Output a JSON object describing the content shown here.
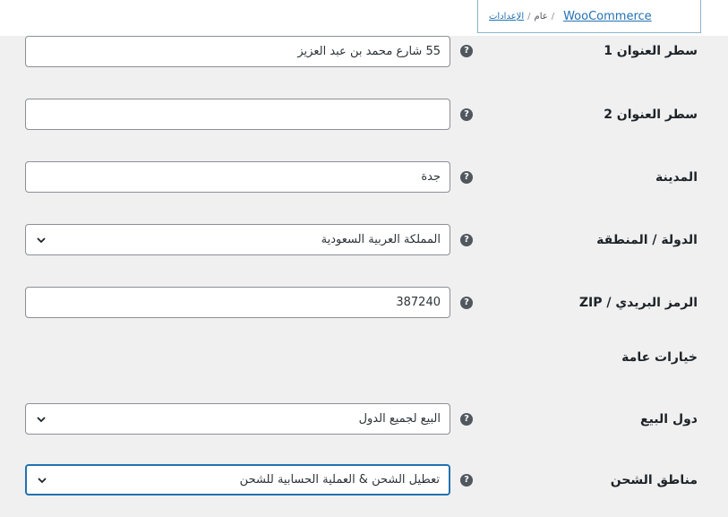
{
  "breadcrumb": {
    "root": "WooCommerce",
    "settings": "الإعدادات",
    "current": "عام",
    "separator": "/"
  },
  "fields": [
    {
      "label": "سطر العنوان 1",
      "value": "55 شارع محمد بن عبد العزيز",
      "type": "text"
    },
    {
      "label": "سطر العنوان 2",
      "value": "",
      "type": "text"
    },
    {
      "label": "المدينة",
      "value": "جدة",
      "type": "text"
    },
    {
      "label": "الدولة / المنطقة",
      "value": "المملكة العربية السعودية",
      "type": "select"
    },
    {
      "label": "الرمز البريدي / ZIP",
      "value": "387240",
      "type": "text"
    }
  ],
  "general_options": {
    "title": "خيارات عامة",
    "fields": [
      {
        "label": "دول البيع",
        "value": "البيع لجميع الدول",
        "type": "select"
      },
      {
        "label": "مناطق الشحن",
        "value": "تعطيل الشحن & العملية الحسابية للشحن",
        "type": "select"
      }
    ]
  },
  "icons": {
    "help": "help-icon",
    "chevron": "chevron-down-icon"
  },
  "colors": {
    "background": "#f0f0f1",
    "link": "#2271b1",
    "focus_border": "#2271b1",
    "help_icon": "#50575e"
  }
}
